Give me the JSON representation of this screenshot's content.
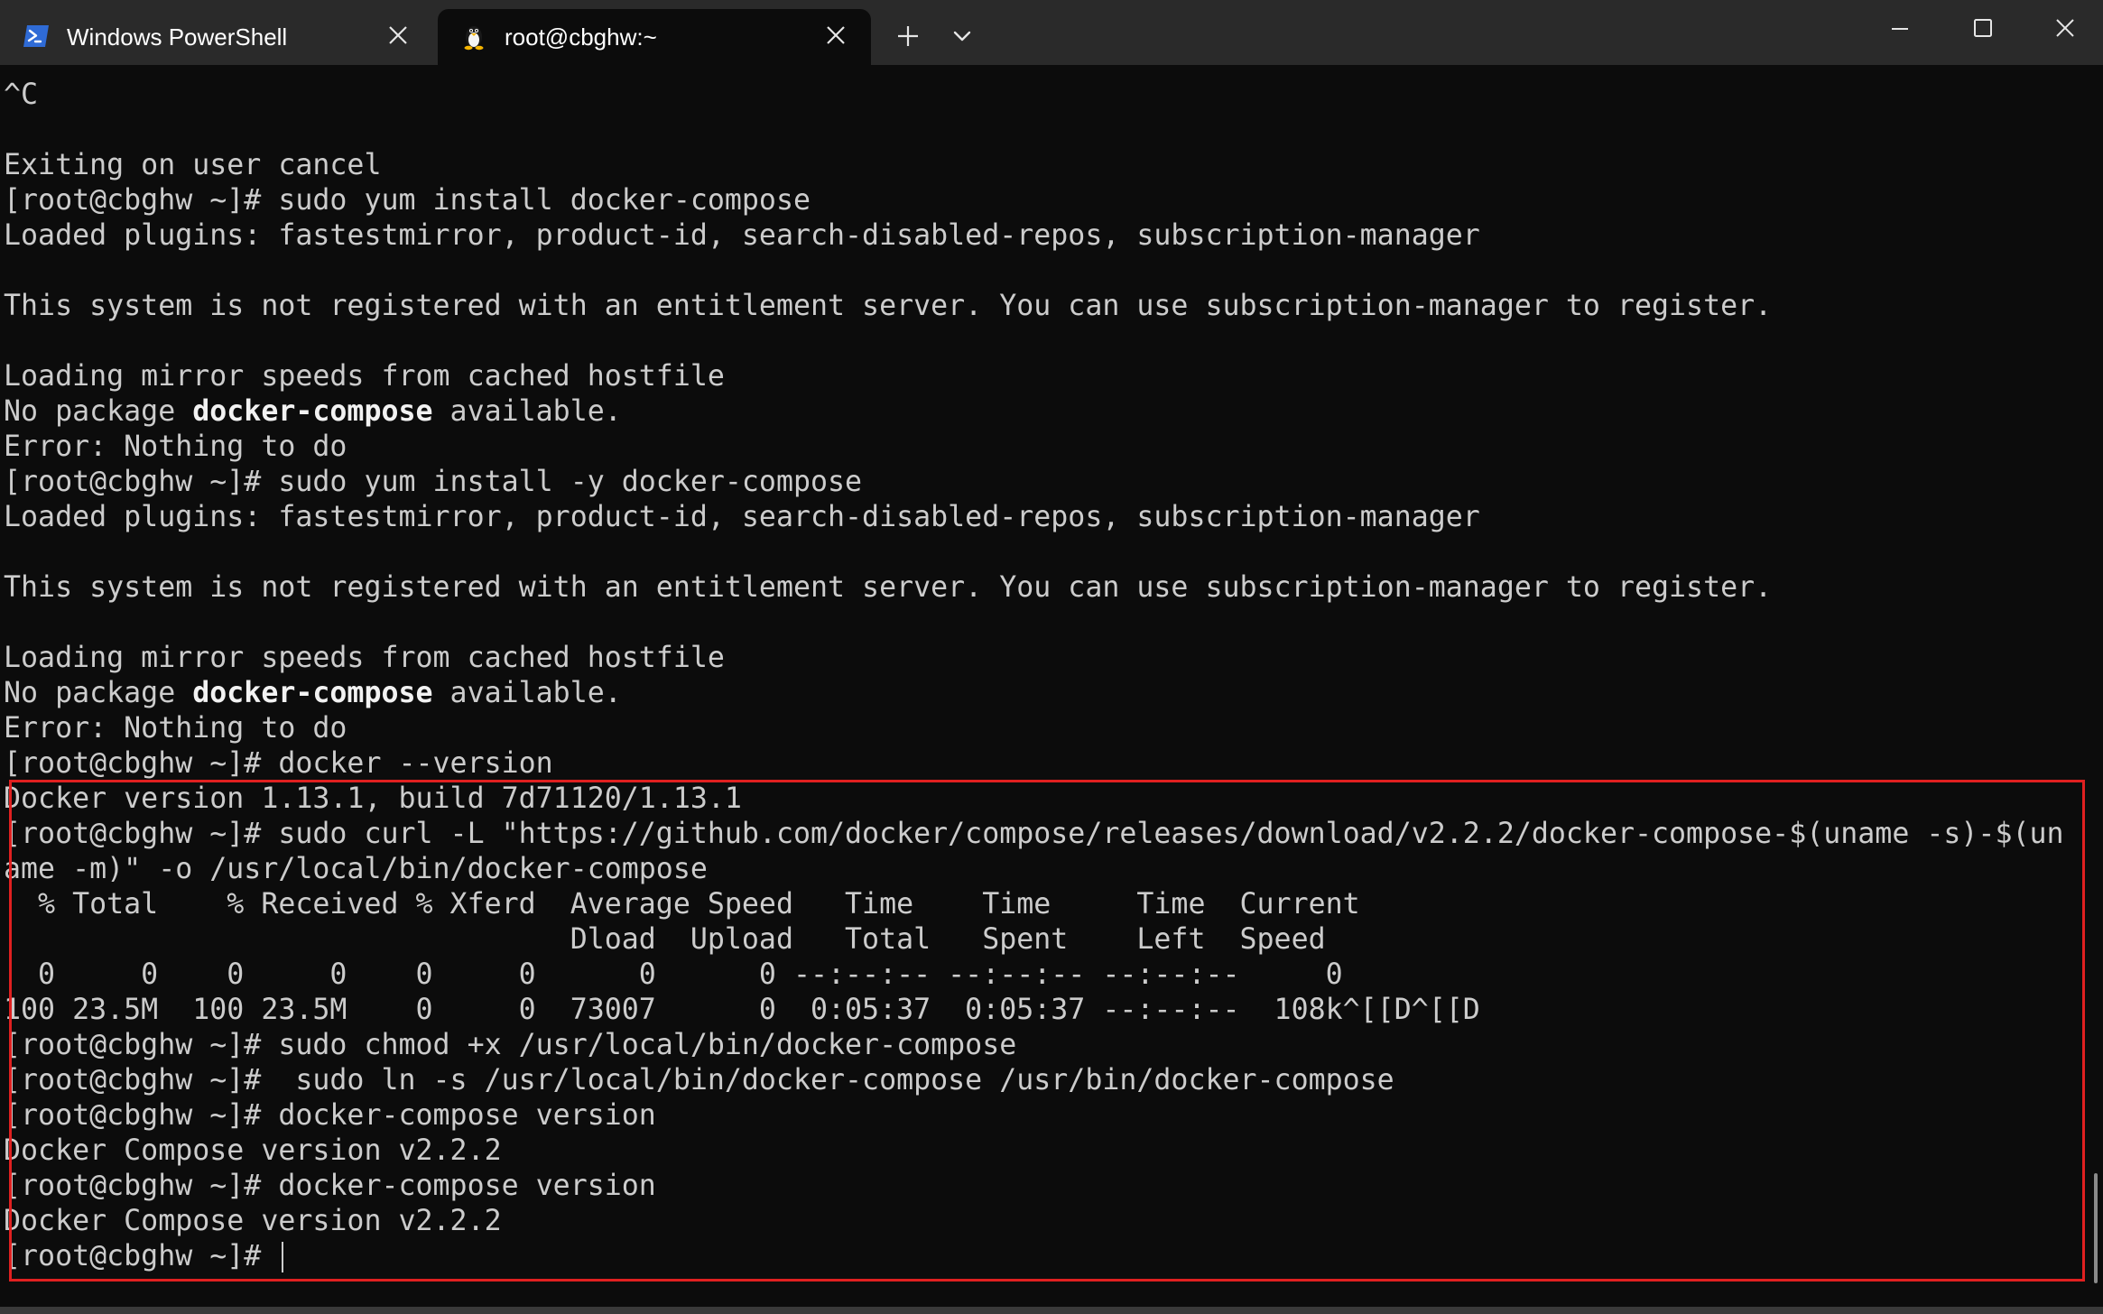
{
  "window": {
    "tabs": [
      {
        "title": "Windows PowerShell",
        "icon": "powershell-icon",
        "active": false
      },
      {
        "title": "root@cbghw:~",
        "icon": "linux-penguin-icon",
        "active": true
      }
    ],
    "controls": [
      "new-tab-icon",
      "chevron-down-icon",
      "minimize-icon",
      "maximize-icon",
      "close-icon"
    ]
  },
  "colors": {
    "terminal_bg": "#0c0c0c",
    "tabbar_bg": "#2a2a2a",
    "text": "#cccccc",
    "bold_text": "#f2f2f2",
    "highlight": "#e02020",
    "powershell_blue": "#2f6bd6"
  },
  "terminal": {
    "lines": [
      "^C",
      "",
      "Exiting on user cancel",
      "[root@cbghw ~]# sudo yum install docker-compose",
      "Loaded plugins: fastestmirror, product-id, search-disabled-repos, subscription-manager",
      "",
      "This system is not registered with an entitlement server. You can use subscription-manager to register.",
      "",
      "Loading mirror speeds from cached hostfile",
      {
        "pre": "No package ",
        "bold": "docker-compose",
        "post": " available."
      },
      "Error: Nothing to do",
      "[root@cbghw ~]# sudo yum install -y docker-compose",
      "Loaded plugins: fastestmirror, product-id, search-disabled-repos, subscription-manager",
      "",
      "This system is not registered with an entitlement server. You can use subscription-manager to register.",
      "",
      "Loading mirror speeds from cached hostfile",
      {
        "pre": "No package ",
        "bold": "docker-compose",
        "post": " available."
      },
      "Error: Nothing to do",
      "[root@cbghw ~]# docker --version",
      "Docker version 1.13.1, build 7d71120/1.13.1",
      "[root@cbghw ~]# sudo curl -L \"https://github.com/docker/compose/releases/download/v2.2.2/docker-compose-$(uname -s)-$(un",
      "ame -m)\" -o /usr/local/bin/docker-compose",
      "  % Total    % Received % Xferd  Average Speed   Time    Time     Time  Current",
      "                                 Dload  Upload   Total   Spent    Left  Speed",
      "  0     0    0     0    0     0      0      0 --:--:-- --:--:-- --:--:--     0",
      "100 23.5M  100 23.5M    0     0  73007      0  0:05:37  0:05:37 --:--:--  108k^[[D^[[D",
      "[root@cbghw ~]# sudo chmod +x /usr/local/bin/docker-compose",
      "[root@cbghw ~]#  sudo ln -s /usr/local/bin/docker-compose /usr/bin/docker-compose",
      "[root@cbghw ~]# docker-compose version",
      "Docker Compose version v2.2.2",
      "[root@cbghw ~]# docker-compose version",
      "Docker Compose version v2.2.2",
      "[root@cbghw ~]# "
    ]
  }
}
